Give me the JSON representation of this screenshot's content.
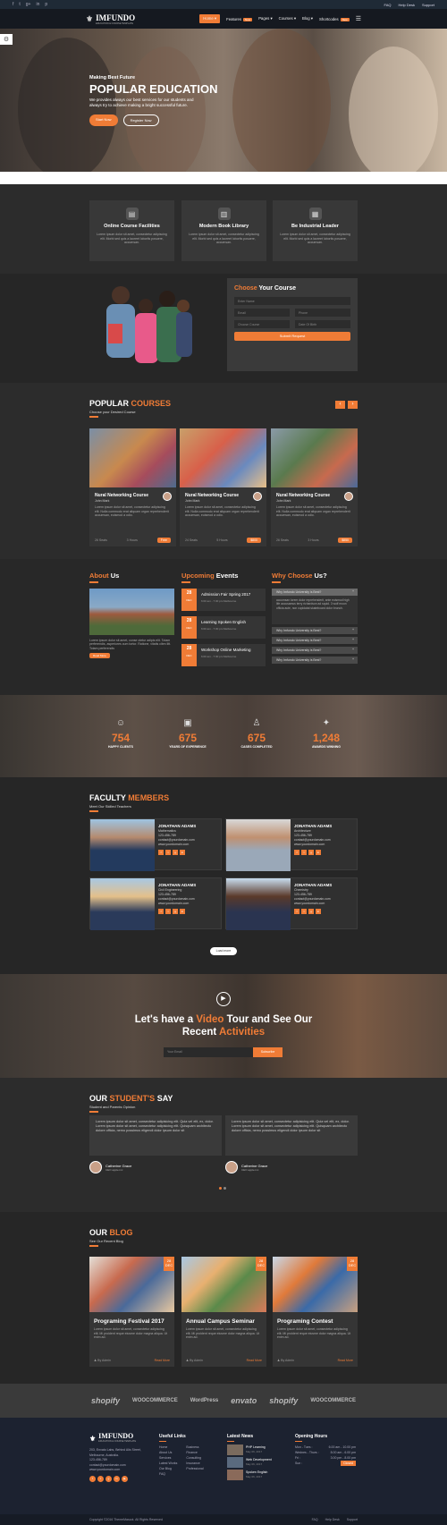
{
  "topbar": {
    "social": [
      "f",
      "t",
      "g+",
      "in",
      "p"
    ],
    "links": [
      "FAQ",
      "Help Desk",
      "Support"
    ]
  },
  "nav": {
    "logo_main": "IMFUNDO",
    "logo_sub": "EDUCATION & COURSE TEMPLATE",
    "items": [
      {
        "label": "Home"
      },
      {
        "label": "Features",
        "badge": "New"
      },
      {
        "label": "Pages"
      },
      {
        "label": "Courses"
      },
      {
        "label": "Blog"
      },
      {
        "label": "Shortcodes",
        "badge": "New"
      }
    ]
  },
  "hero": {
    "pre": "Making Best Future",
    "title": "POPULAR EDUCATION",
    "desc": "We provides always our best services for our students and always try to achieve making a bright successful future.",
    "btn1": "Start Now",
    "btn2": "Register Now"
  },
  "features": [
    {
      "icon": "pc",
      "title": "Online Course Facilities",
      "text": "Lorem ipsum dolor sit amet, consectetur adipiscing elit. Morbi sed quis a laoreet lobortis posuere, accumsan."
    },
    {
      "icon": "book",
      "title": "Modern Book Library",
      "text": "Lorem ipsum dolor sit amet, consectetur adipiscing elit. Morbi sed quis a laoreet lobortis posuere, accumsan."
    },
    {
      "icon": "cap",
      "title": "Be Industrial Leader",
      "text": "Lorem ipsum dolor sit amet, consectetur adipiscing elit. Morbi sed quis a laoreet lobortis posuere, accumsan."
    }
  ],
  "choose": {
    "title_a": "Choose",
    "title_b": "Your Course",
    "name": "Enter Name",
    "email": "Email",
    "phone": "Phone",
    "course": "Choose Course",
    "dob": "Date Of Birth",
    "submit": "Submit Request"
  },
  "courses": {
    "title_a": "POPULAR",
    "title_b": "COURSES",
    "sub": "Choose your Desired Course",
    "items": [
      {
        "title": "Nural Networking Course",
        "author": "John Mark",
        "desc": "Lorem ipsum dolor sit amet, consectetur adipiscing elit. Nulla commodo erat aliquam organ reprehenderit accumsan, euismod a odio.",
        "seats": "26 Seats",
        "hours": "3 Hours",
        "price": "Free"
      },
      {
        "title": "Nural Networking Course",
        "author": "John Mark",
        "desc": "Lorem ipsum dolor sit amet, consectetur adipiscing elit. Nulla commodo erat aliquam organ reprehenderit accumsan, euismod a odio.",
        "seats": "24 Seats",
        "hours": "5 Hours",
        "price": "$800"
      },
      {
        "title": "Nural Networking Course",
        "author": "John Mark",
        "desc": "Lorem ipsum dolor sit amet, consectetur adipiscing elit. Nulla commodo erat aliquam organ reprehenderit accumsan, euismod a odio.",
        "seats": "26 Seats",
        "hours": "3 Hours",
        "price": "$850"
      }
    ]
  },
  "about": {
    "title_a": "About",
    "title_b": "Us",
    "text": "Lorem ipsum dolor sit amet, conse ctetur adipis elit. Totam perferendis, asperiores cum tortor. Ratione, vitatis cibm litt. Totam perferendis",
    "btn": "Read More"
  },
  "upcoming": {
    "title_a": "Upcoming",
    "title_b": "Events",
    "items": [
      {
        "day": "28",
        "mon": "DEC",
        "title": "Admission Fair Spring 2017",
        "meta": "6:00 am - 7:30 pm  Melbourne"
      },
      {
        "day": "28",
        "mon": "DEC",
        "title": "Learning Spoken English",
        "meta": "6:00 am - 7:30 pm  Melbourne"
      },
      {
        "day": "28",
        "mon": "DEC",
        "title": "Workshop Online Marketing",
        "meta": "6:00 am - 7:30 pm  Melbourne"
      }
    ]
  },
  "why": {
    "title_a": "Why Choose",
    "title_b": "Us?",
    "open": "Why Imfundo University is Best?",
    "body": "accumsan lorem dolor reprehenderit, ante euismod high life accusamus terry richardson ad squid. 3 wolf moon officia aute, non cupidatat skateboard dolor brunch.",
    "items": [
      "Why Imfundo University is Best?",
      "Why Imfundo University is Best?",
      "Why Imfundo University is Best?",
      "Why Imfundo University is Best?"
    ]
  },
  "stats": [
    {
      "icon": "☺",
      "num": "754",
      "label": "HAPPY CLIENTS"
    },
    {
      "icon": "▣",
      "num": "675",
      "label": "YEARS OF EXPERIENCE"
    },
    {
      "icon": "♙",
      "num": "675",
      "label": "CASES COMPLETED"
    },
    {
      "icon": "✦",
      "num": "1,248",
      "label": "AWARDS WINNING"
    }
  ],
  "faculty": {
    "title_a": "FACULTY",
    "title_b": "MEMBERS",
    "sub": "Meet Our Skilled Teachers",
    "members": [
      {
        "name": "JONATHAN ADAMS",
        "role": "Mathematics",
        "phone": "123-456-789",
        "email": "contact@yourdomain.com",
        "web": "www.yourdomain.com"
      },
      {
        "name": "JONATHAN ADAMS",
        "role": "Architecture",
        "phone": "123-456-789",
        "email": "contact@yourdomain.com",
        "web": "www.yourdomain.com"
      },
      {
        "name": "JONATHAN ADAMS",
        "role": "Civil Engineering",
        "phone": "123-456-789",
        "email": "contact@yourdomain.com",
        "web": "www.yourdomain.com"
      },
      {
        "name": "JONATHAN ADAMS",
        "role": "Chemistry",
        "phone": "123-456-789",
        "email": "contact@yourdomain.com",
        "web": "www.yourdomain.com"
      }
    ],
    "load": "Load more"
  },
  "video": {
    "l1a": "Let's have a",
    "l1b": "Video",
    "l1c": "Tour and See Our",
    "l2a": "Recent",
    "l2b": "Activities",
    "email": "Your Email",
    "btn": "Subscribe"
  },
  "testi": {
    "title_a": "OUR",
    "title_b": "STUDENT'S",
    "title_c": "SAY",
    "sub": "Student and Parents Opinion",
    "quote": "Lorem ipsum dolor sit amet, consectetur adipisicing elit. Quia vel elit, ex, dolor. Lorem ipsum dolor sit amet, consectetur adipisicing elit. Quisquam architecto dolore officia, nemo possimus eligendi dolor ipsum dolor sit",
    "items": [
      {
        "name": "Catherine Grace",
        "role": "CEO apple.inc"
      },
      {
        "name": "Catherine Grace",
        "role": "CEO apple.inc"
      }
    ]
  },
  "blog": {
    "title_a": "OUR",
    "title_b": "BLOG",
    "sub": "See Our Recent Blog",
    "items": [
      {
        "day": "28",
        "mon": "DEC",
        "title": "Programing Festival 2017",
        "text": "Lorem ipsum dolor sit amet, consectetur adipiscing elit. Mi proident reque eiusme dolor magna aliqua. Ut enim ad.",
        "author": "By Admin",
        "more": "Read More"
      },
      {
        "day": "28",
        "mon": "DEC",
        "title": "Annual Campus Seminar",
        "text": "Lorem ipsum dolor sit amet, consectetur adipiscing elit. Mi proident reque eiusme dolor magna aliqua. Ut enim ad.",
        "author": "By Admin",
        "more": "Read More"
      },
      {
        "day": "28",
        "mon": "DEC",
        "title": "Programing Contest",
        "text": "Lorem ipsum dolor sit amet, consectetur adipiscing elit. Mi proident reque eiusme dolor magna aliqua. Ut enim ad.",
        "author": "By Admin",
        "more": "Read More"
      }
    ]
  },
  "brands": [
    "shopify",
    "WOOCOMMERCE",
    "WordPress",
    "envato",
    "shopify",
    "WOOCOMMERCE"
  ],
  "footer": {
    "address": [
      "203, Envato Labs, Behind Alis Street,",
      "Melbourne, Australia.",
      "123-456-789",
      "contact@yourdomain.com",
      "www.yourdomain.com"
    ],
    "useful_title": "Useful Links",
    "useful_a": [
      "Home",
      "About Us",
      "Services",
      "Latest Works",
      "Our Blog",
      "FAQ"
    ],
    "useful_b": [
      "Business",
      "Finance",
      "Consulting",
      "Insurance",
      "Professional"
    ],
    "news_title": "Latest News",
    "news": [
      {
        "title": "PHP Learning",
        "date": "May 06, 2017"
      },
      {
        "title": "Web Development",
        "date": "May 06, 2017"
      },
      {
        "title": "Spoken English",
        "date": "May 06, 2017"
      }
    ],
    "hours_title": "Opening Hours",
    "hours": [
      {
        "d": "Mon - Tues :",
        "t": "6.00 am - 10.00 pm"
      },
      {
        "d": "Wednes - Thurs :",
        "t": "8.00 am - 6.00 pm"
      },
      {
        "d": "Fri :",
        "t": "3.00 pm - 8.00 pm"
      },
      {
        "d": "Sun :",
        "t": "Closed"
      }
    ],
    "copy": "Copyright ©2016 ThemeMascot. All Rights Reserved",
    "links": [
      "FAQ",
      "Help Desk",
      "Support"
    ]
  }
}
